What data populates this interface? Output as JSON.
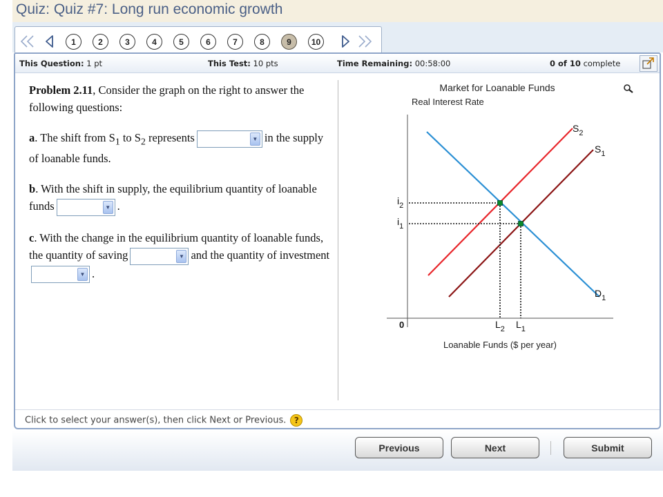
{
  "title": "Quiz:  Quiz #7: Long run economic growth",
  "nav": {
    "questions": [
      "1",
      "2",
      "3",
      "4",
      "5",
      "6",
      "7",
      "8",
      "9",
      "10"
    ],
    "current": "9"
  },
  "info": {
    "this_question_label": "This Question:",
    "this_question_value": "1 pt",
    "this_test_label": "This Test:",
    "this_test_value": "10 pts",
    "time_label": "Time Remaining:",
    "time_value": "00:58:00",
    "complete_count": "0 of 10",
    "complete_label": "complete"
  },
  "problem": {
    "label": "Problem 2.11",
    "intro": ", Consider the graph on the right to answer the following questions:",
    "a_label": "a",
    "a_text_1": ". The shift from S",
    "a_sub_1": "1",
    "a_text_2": " to S",
    "a_sub_2": "2",
    "a_text_3": " represents",
    "a_text_4": "in the supply of loanable funds.",
    "b_label": "b",
    "b_text_1": ". With the shift in supply, the equilibrium quantity of loanable funds",
    "b_text_2": ".",
    "c_label": "c",
    "c_text_1": ". With the change in the equilibrium quantity of loanable funds, the quantity of saving",
    "c_text_2": "and the quantity of investment",
    "c_text_3": "."
  },
  "graph": {
    "title": "Market for Loanable Funds",
    "ylabel": "Real Interest Rate",
    "xlabel": "Loanable Funds ($ per year)",
    "origin": "0",
    "s2_label": "S",
    "s2_sub": "2",
    "s1_label": "S",
    "s1_sub": "1",
    "d1_label": "D",
    "d1_sub": "1",
    "i2_label": "i",
    "i2_sub": "2",
    "i1_label": "i",
    "i1_sub": "1",
    "l2_label": "L",
    "l2_sub": "2",
    "l1_label": "L",
    "l1_sub": "1",
    "colors": {
      "demand": "#2a8fd4",
      "s1": "#8b1414",
      "s2": "#e8252a",
      "point": "#0a8a2a"
    }
  },
  "footer_hint": "Click to select your answer(s), then click Next or Previous.",
  "buttons": {
    "previous": "Previous",
    "next": "Next",
    "submit": "Submit"
  }
}
